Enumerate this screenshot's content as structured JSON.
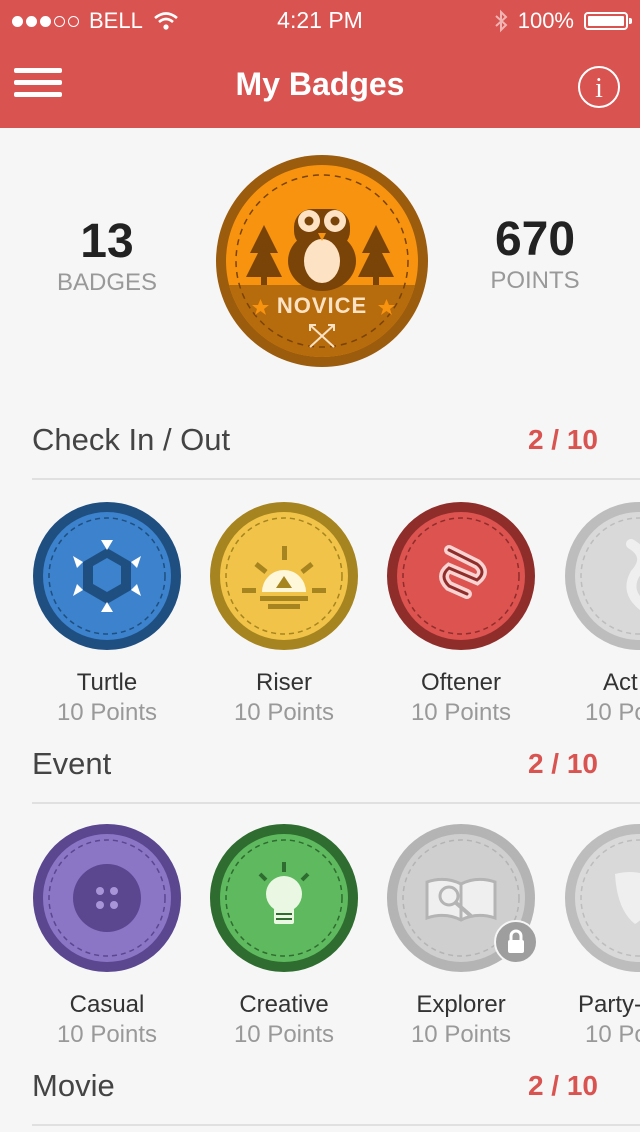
{
  "status_bar": {
    "carrier": "BELL",
    "time": "4:21 PM",
    "battery": "100%"
  },
  "nav": {
    "title": "My Badges",
    "info_label": "i"
  },
  "summary": {
    "badges_count": "13",
    "badges_label": "BADGES",
    "points_count": "670",
    "points_label": "POINTS",
    "level_badge_label": "NOVICE"
  },
  "sections": [
    {
      "title": "Check In / Out",
      "progress": "2 / 10",
      "badges": [
        {
          "name": "Turtle",
          "points": "10 Points",
          "color": "#2f6aa8"
        },
        {
          "name": "Riser",
          "points": "10 Points",
          "color": "#e9b93a"
        },
        {
          "name": "Oftener",
          "points": "10 Points",
          "color": "#cc4a47"
        },
        {
          "name": "Act",
          "points": "10 Po",
          "color": "#cccccc"
        }
      ]
    },
    {
      "title": "Event",
      "progress": "2 / 10",
      "badges": [
        {
          "name": "Casual",
          "points": "10 Points",
          "color": "#7b63ae"
        },
        {
          "name": "Creative",
          "points": "10 Points",
          "color": "#4aa24d"
        },
        {
          "name": "Explorer",
          "points": "10 Points",
          "color": "#c8c8c8"
        },
        {
          "name": "Party-",
          "points": "10 Po",
          "color": "#cccccc"
        }
      ]
    },
    {
      "title": "Movie",
      "progress": "2 / 10"
    }
  ]
}
